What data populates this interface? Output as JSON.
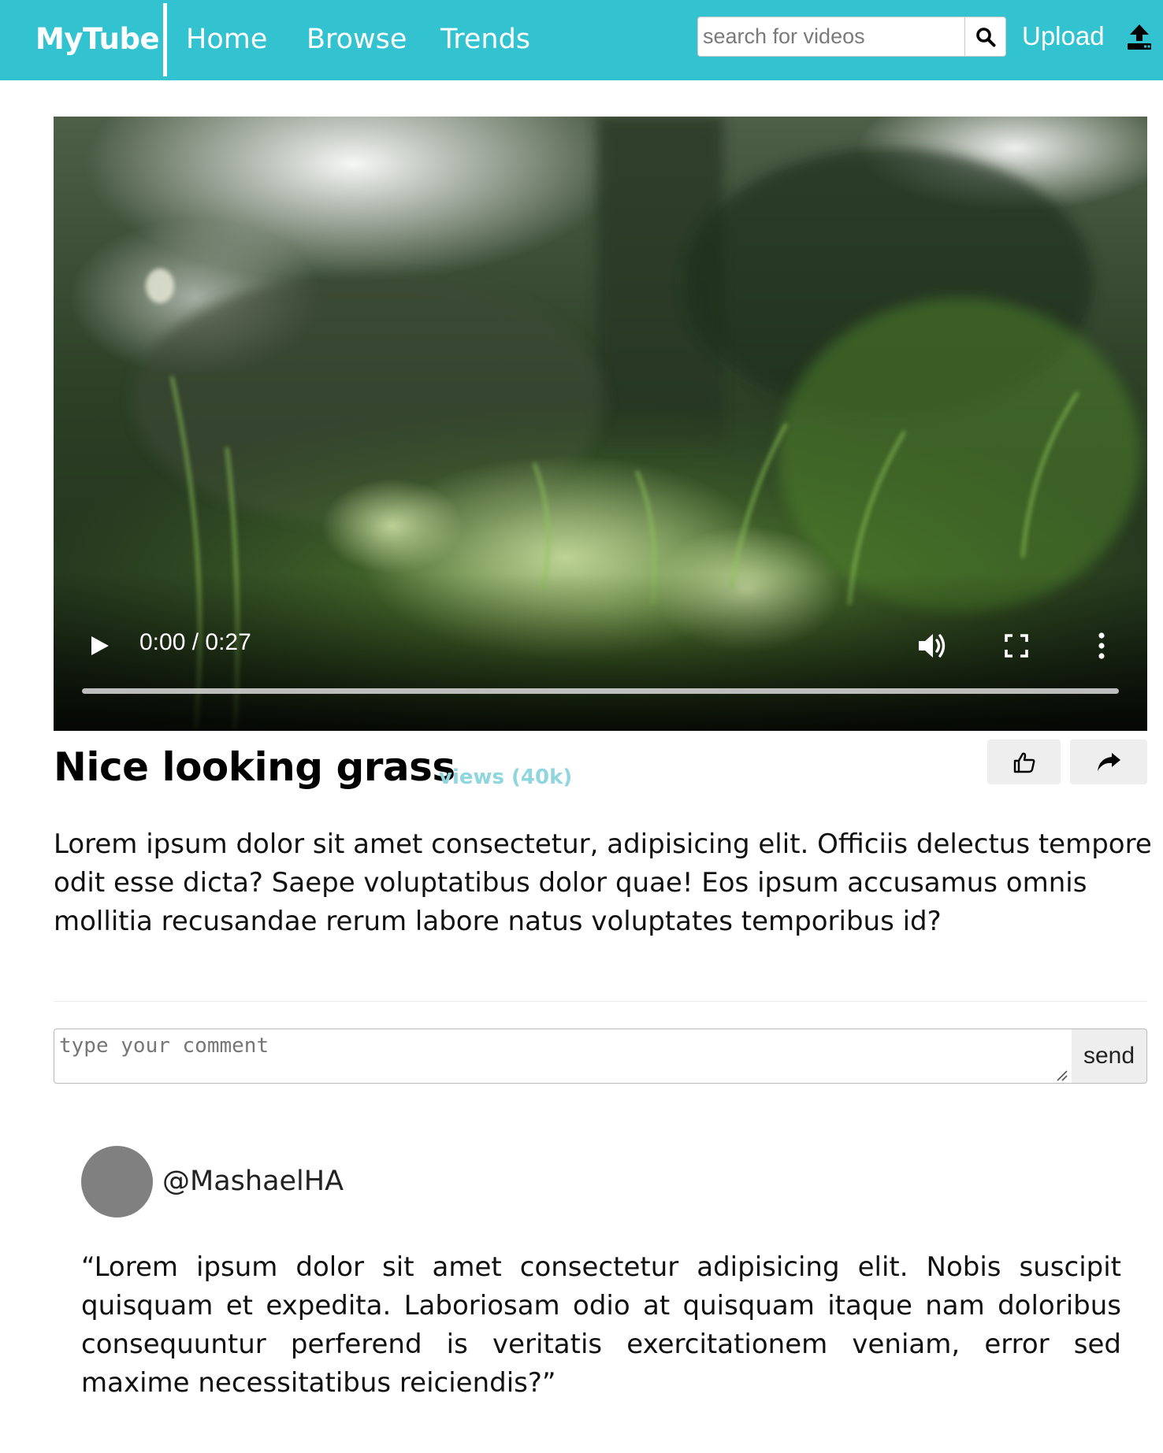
{
  "navbar": {
    "brand": "MyTube",
    "links": [
      "Home",
      "Browse",
      "Trends"
    ],
    "search_placeholder": "search for videos",
    "upload_label": "Upload",
    "background_color": "#33c3d0"
  },
  "video": {
    "time_display": "0:00 / 0:27",
    "progress": 0,
    "icons": [
      "play-icon",
      "volume-icon",
      "fullscreen-icon",
      "more-options-icon"
    ]
  },
  "title_row": {
    "title": "Nice looking grass",
    "views": "views (40k)",
    "icons": [
      "thumbs-up-icon",
      "share-arrow-icon"
    ]
  },
  "description": "Lorem ipsum dolor sit amet consectetur, adipisicing elit. Officiis delectus tempore odit esse dicta? Saepe voluptatibus dolor quae! Eos ipsum accusamus omnis mollitia recusandae rerum labore natus voluptates temporibus id?",
  "comment_form": {
    "placeholder": "type your comment",
    "send_label": "send"
  },
  "comments": [
    {
      "username": "@MashaelHA",
      "text": "“Lorem ipsum dolor sit amet consectetur adipisicing elit. Nobis suscipit quisquam et expedita. Laboriosam odio at quisquam itaque nam doloribus consequuntur perferend is veritatis exercitationem veniam, error sed maxime necessitatibus reiciendis?”"
    }
  ]
}
